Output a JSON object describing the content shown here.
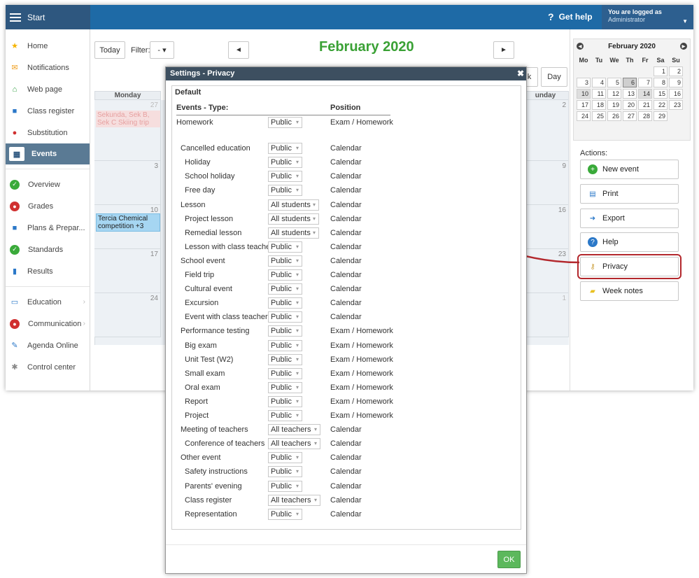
{
  "topbar": {
    "start_label": "Start",
    "help_label": "Get help",
    "help_icon": "?",
    "logged_line1": "You are logged as",
    "logged_line2": "Administrator"
  },
  "sidebar": {
    "items": [
      {
        "label": "Home",
        "icon": "star-icon",
        "glyph": "★",
        "color": "#f5b400"
      },
      {
        "label": "Notifications",
        "icon": "envelope-icon",
        "glyph": "✉",
        "color": "#f0a020"
      },
      {
        "label": "Web page",
        "icon": "house-icon",
        "glyph": "⌂",
        "color": "#2a9a3a"
      },
      {
        "label": "Class register",
        "icon": "book-icon",
        "glyph": "■",
        "color": "#2b78c8"
      },
      {
        "label": "Substitution",
        "icon": "person-icon",
        "glyph": "●",
        "color": "#d03030"
      },
      {
        "label": "Events",
        "icon": "calendar-icon",
        "glyph": "▦",
        "color": "#ffffff"
      },
      {
        "label": "Overview",
        "icon": "check-icon",
        "glyph": "✓",
        "color": "#3aaa3a"
      },
      {
        "label": "Grades",
        "icon": "grades-icon",
        "glyph": "●",
        "color": "#d03030"
      },
      {
        "label": "Plans & Prepar...",
        "icon": "briefcase-icon",
        "glyph": "■",
        "color": "#2b78c8"
      },
      {
        "label": "Standards",
        "icon": "shield-icon",
        "glyph": "✓",
        "color": "#3aaa3a"
      },
      {
        "label": "Results",
        "icon": "bar-chart-icon",
        "glyph": "▮",
        "color": "#2b78c8"
      },
      {
        "label": "Education",
        "icon": "open-book-icon",
        "glyph": "▭",
        "color": "#2b78c8"
      },
      {
        "label": "Communication",
        "icon": "chat-icon",
        "glyph": "●",
        "color": "#d03030"
      },
      {
        "label": "Agenda Online",
        "icon": "pen-icon",
        "glyph": "✎",
        "color": "#2b78c8"
      },
      {
        "label": "Control center",
        "icon": "gear-icon",
        "glyph": "✱",
        "color": "#888888"
      }
    ]
  },
  "toolbar": {
    "today_label": "Today",
    "filter_label": "Filter:",
    "filter_value": "-",
    "filter_caret": "▾",
    "prev_glyph": "◄",
    "next_glyph": "►",
    "month_title": "February 2020",
    "week_label": "k",
    "day_label": "Day"
  },
  "calendar": {
    "col_monday": "Monday",
    "col_sunday": "unday",
    "days_mon": [
      "27",
      "3",
      "10",
      "17",
      "24"
    ],
    "days_sun": [
      "2",
      "9",
      "16",
      "23",
      "1"
    ],
    "event1": "Sekunda, Sek B, Sek C Skiing trip",
    "event2": "Tercia Chemical competition +3"
  },
  "minical": {
    "title": "February 2020",
    "prev": "◀",
    "next": "▶",
    "weekdays": [
      "Mo",
      "Tu",
      "We",
      "Th",
      "Fr",
      "Sa",
      "Su"
    ],
    "weeks": [
      [
        "",
        "",
        "",
        "",
        "",
        "1",
        "2"
      ],
      [
        "3",
        "4",
        "5",
        "6",
        "7",
        "8",
        "9"
      ],
      [
        "10",
        "11",
        "12",
        "13",
        "14",
        "15",
        "16"
      ],
      [
        "17",
        "18",
        "19",
        "20",
        "21",
        "22",
        "23"
      ],
      [
        "24",
        "25",
        "26",
        "27",
        "28",
        "29",
        ""
      ]
    ]
  },
  "actions": {
    "label": "Actions:",
    "items": [
      {
        "label": "New event",
        "icon": "plus-icon",
        "glyph": "+",
        "color": "#3aaa3a"
      },
      {
        "label": "Print",
        "icon": "printer-icon",
        "glyph": "▤",
        "color": "#2b78c8"
      },
      {
        "label": "Export",
        "icon": "export-icon",
        "glyph": "➜",
        "color": "#2b78c8"
      },
      {
        "label": "Help",
        "icon": "help-icon",
        "glyph": "?",
        "color": "#2b78c8"
      },
      {
        "label": "Privacy",
        "icon": "key-icon",
        "glyph": "⚷",
        "color": "#c89a30"
      },
      {
        "label": "Week notes",
        "icon": "note-icon",
        "glyph": "▰",
        "color": "#e8c020"
      }
    ]
  },
  "dialog": {
    "title": "Settings - Privacy",
    "close": "✖",
    "section": "Default",
    "col_type": "Events - Type:",
    "col_position": "Position",
    "ok_label": "OK",
    "caret": "▾",
    "rows": [
      {
        "name": "Homework",
        "indent": 0,
        "value": "Public",
        "position": "Exam / Homework"
      },
      {
        "name": "Cancelled education",
        "indent": 1,
        "value": "Public",
        "position": "Calendar"
      },
      {
        "name": "Holiday",
        "indent": 2,
        "value": "Public",
        "position": "Calendar"
      },
      {
        "name": "School holiday",
        "indent": 2,
        "value": "Public",
        "position": "Calendar"
      },
      {
        "name": "Free day",
        "indent": 2,
        "value": "Public",
        "position": "Calendar"
      },
      {
        "name": "Lesson",
        "indent": 1,
        "value": "All students",
        "position": "Calendar"
      },
      {
        "name": "Project lesson",
        "indent": 2,
        "value": "All students",
        "position": "Calendar"
      },
      {
        "name": "Remedial lesson",
        "indent": 2,
        "value": "All students",
        "position": "Calendar"
      },
      {
        "name": "Lesson with class teacher",
        "indent": 2,
        "value": "Public",
        "position": "Calendar"
      },
      {
        "name": "School event",
        "indent": 1,
        "value": "Public",
        "position": "Calendar"
      },
      {
        "name": "Field trip",
        "indent": 2,
        "value": "Public",
        "position": "Calendar"
      },
      {
        "name": "Cultural event",
        "indent": 2,
        "value": "Public",
        "position": "Calendar"
      },
      {
        "name": "Excursion",
        "indent": 2,
        "value": "Public",
        "position": "Calendar"
      },
      {
        "name": "Event with class teacher",
        "indent": 2,
        "value": "Public",
        "position": "Calendar"
      },
      {
        "name": "Performance testing",
        "indent": 1,
        "value": "Public",
        "position": "Exam / Homework"
      },
      {
        "name": "Big exam",
        "indent": 2,
        "value": "Public",
        "position": "Exam / Homework"
      },
      {
        "name": "Unit Test (W2)",
        "indent": 2,
        "value": "Public",
        "position": "Exam / Homework"
      },
      {
        "name": "Small exam",
        "indent": 2,
        "value": "Public",
        "position": "Exam / Homework"
      },
      {
        "name": "Oral exam",
        "indent": 2,
        "value": "Public",
        "position": "Exam / Homework"
      },
      {
        "name": "Report",
        "indent": 2,
        "value": "Public",
        "position": "Exam / Homework"
      },
      {
        "name": "Project",
        "indent": 2,
        "value": "Public",
        "position": "Exam / Homework"
      },
      {
        "name": "Meeting of teachers",
        "indent": 1,
        "value": "All teachers",
        "position": "Calendar"
      },
      {
        "name": "Conference of teachers",
        "indent": 2,
        "value": "All teachers",
        "position": "Calendar"
      },
      {
        "name": "Other event",
        "indent": 1,
        "value": "Public",
        "position": "Calendar"
      },
      {
        "name": "Safety instructions",
        "indent": 2,
        "value": "Public",
        "position": "Calendar"
      },
      {
        "name": "Parents' evening",
        "indent": 2,
        "value": "Public",
        "position": "Calendar"
      },
      {
        "name": "Class register",
        "indent": 2,
        "value": "All teachers",
        "position": "Calendar"
      },
      {
        "name": "Representation",
        "indent": 2,
        "value": "Public",
        "position": "Calendar"
      }
    ]
  },
  "colors": {
    "accent": "#1e6aa6",
    "title_green": "#3aa135",
    "highlight_red": "#b3282d",
    "ok_green": "#5cb85c"
  }
}
